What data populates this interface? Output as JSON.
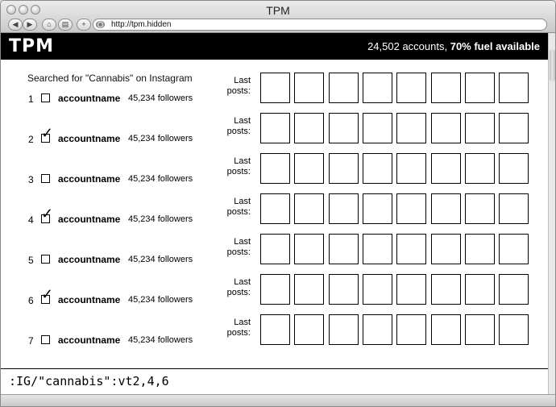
{
  "window": {
    "title": "TPM"
  },
  "toolbar": {
    "back_icon": "◀",
    "forward_icon": "▶",
    "home_icon": "⌂",
    "print_icon": "▤",
    "add_icon": "+",
    "url": "http://tpm.hidden"
  },
  "app": {
    "logo": "TPM",
    "accounts_text": "24,502 accounts, ",
    "fuel_text": "70% fuel available"
  },
  "search": {
    "heading": "Searched for \"Cannabis\" on Instagram"
  },
  "last_posts_label": "Last posts:",
  "check_glyph": "✓",
  "results": [
    {
      "num": "1",
      "checked": false,
      "account": "accountname",
      "followers": "45,234 followers"
    },
    {
      "num": "2",
      "checked": true,
      "account": "accountname",
      "followers": "45,234 followers"
    },
    {
      "num": "3",
      "checked": false,
      "account": "accountname",
      "followers": "45,234 followers"
    },
    {
      "num": "4",
      "checked": true,
      "account": "accountname",
      "followers": "45,234 followers"
    },
    {
      "num": "5",
      "checked": false,
      "account": "accountname",
      "followers": "45,234 followers"
    },
    {
      "num": "6",
      "checked": true,
      "account": "accountname",
      "followers": "45,234 followers"
    },
    {
      "num": "7",
      "checked": false,
      "account": "accountname",
      "followers": "45,234 followers"
    }
  ],
  "thumbnails_per_row": 8,
  "command": {
    "value": ":IG/\"cannabis\":vt2,4,6"
  }
}
